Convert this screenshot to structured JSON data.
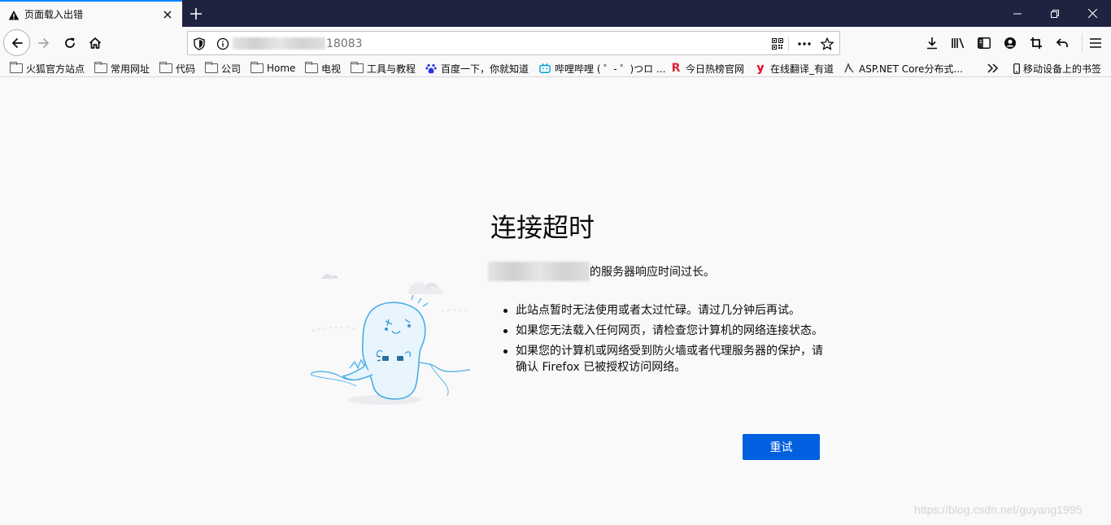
{
  "tab": {
    "title": "页面载入出错",
    "icon": "warning-icon"
  },
  "window_controls": [
    "minimize-icon",
    "restore-icon",
    "close-icon"
  ],
  "urlbar": {
    "url_visible": "18083"
  },
  "bookmarks": [
    {
      "label": "火狐官方站点",
      "icon": "folder"
    },
    {
      "label": "常用网址",
      "icon": "folder"
    },
    {
      "label": "代码",
      "icon": "folder"
    },
    {
      "label": "公司",
      "icon": "folder"
    },
    {
      "label": "Home",
      "icon": "folder"
    },
    {
      "label": "电视",
      "icon": "folder"
    },
    {
      "label": "工具与教程",
      "icon": "folder"
    },
    {
      "label": "百度一下，你就知道",
      "icon": "baidu"
    },
    {
      "label": "哔哩哔哩 ( ゜- ゜)つロ ...",
      "icon": "bilibili"
    },
    {
      "label": "今日热榜官网",
      "icon": "r"
    },
    {
      "label": "在线翻译_有道",
      "icon": "youdao"
    },
    {
      "label": "ASP.NET Core分布式...",
      "icon": "aspnet"
    },
    {
      "label": "移动设备上的书签",
      "icon": "mobile"
    }
  ],
  "error": {
    "title": "连接超时",
    "description": "的服务器响应时间过长。",
    "tips": [
      "此站点暂时无法使用或者太过忙碌。请过几分钟后再试。",
      "如果您无法载入任何网页，请检查您计算机的网络连接状态。",
      "如果您的计算机或网络受到防火墙或者代理服务器的保护，请确认 Firefox 已被授权访问网络。"
    ],
    "retry_label": "重试"
  },
  "watermark": "https://blog.csdn.net/guyang1995",
  "colors": {
    "tabbar_bg": "#202340",
    "accent": "#0a84ff",
    "button_bg": "#0060df",
    "page_bg": "#f9f9fa"
  }
}
